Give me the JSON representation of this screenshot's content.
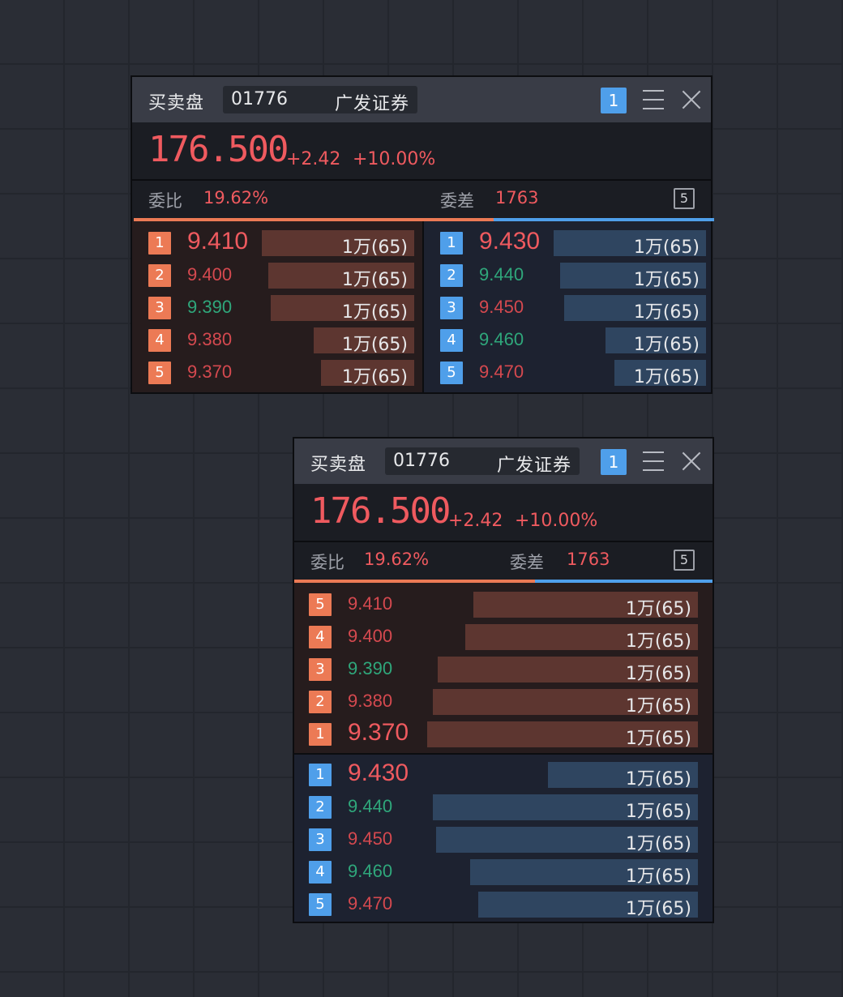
{
  "window": {
    "title": "买卖盘",
    "code": "01776",
    "name": "广发证券",
    "account_badge": "1",
    "price": "176.500",
    "change": "+2.42",
    "change_pct": "+10.00%",
    "ratio_label": "委比",
    "ratio_value": "19.62%",
    "diff_label": "委差",
    "diff_value": "1763",
    "levels_toggle": "5"
  },
  "colors": {
    "up": "#ef5a5f",
    "down": "#2fa77b",
    "bid_bar": "#5d3630",
    "ask_bar": "#2f4560",
    "bid_badge": "#ec7a55",
    "ask_badge": "#4f9fea"
  },
  "panel1": {
    "layout": "side-by-side",
    "depth_bid_share": 0.62,
    "bids": [
      {
        "level": "1",
        "price": "9.410",
        "volume": "1万(65)",
        "trend": "up",
        "fill": 1.0
      },
      {
        "level": "2",
        "price": "9.400",
        "volume": "1万(65)",
        "trend": "up",
        "fill": 0.96
      },
      {
        "level": "3",
        "price": "9.390",
        "volume": "1万(65)",
        "trend": "down",
        "fill": 0.94
      },
      {
        "level": "4",
        "price": "9.380",
        "volume": "1万(65)",
        "trend": "up",
        "fill": 0.66
      },
      {
        "level": "5",
        "price": "9.370",
        "volume": "1万(65)",
        "trend": "up",
        "fill": 0.61
      }
    ],
    "asks": [
      {
        "level": "1",
        "price": "9.430",
        "volume": "1万(65)",
        "trend": "up",
        "fill": 1.0
      },
      {
        "level": "2",
        "price": "9.440",
        "volume": "1万(65)",
        "trend": "down",
        "fill": 0.96
      },
      {
        "level": "3",
        "price": "9.450",
        "volume": "1万(65)",
        "trend": "up",
        "fill": 0.93
      },
      {
        "level": "4",
        "price": "9.460",
        "volume": "1万(65)",
        "trend": "down",
        "fill": 0.66
      },
      {
        "level": "5",
        "price": "9.470",
        "volume": "1万(65)",
        "trend": "up",
        "fill": 0.6
      }
    ]
  },
  "panel2": {
    "layout": "stacked",
    "depth_bid_share": 0.575,
    "bids": [
      {
        "level": "5",
        "price": "9.410",
        "volume": "1万(65)",
        "trend": "up",
        "fill": 0.83
      },
      {
        "level": "4",
        "price": "9.400",
        "volume": "1万(65)",
        "trend": "up",
        "fill": 0.86
      },
      {
        "level": "3",
        "price": "9.390",
        "volume": "1万(65)",
        "trend": "down",
        "fill": 0.96
      },
      {
        "level": "2",
        "price": "9.380",
        "volume": "1万(65)",
        "trend": "up",
        "fill": 0.98
      },
      {
        "level": "1",
        "price": "9.370",
        "volume": "1万(65)",
        "trend": "up",
        "fill": 1.0
      }
    ],
    "asks": [
      {
        "level": "1",
        "price": "9.430",
        "volume": "1万(65)",
        "trend": "up",
        "fill": 0.56
      },
      {
        "level": "2",
        "price": "9.440",
        "volume": "1万(65)",
        "trend": "down",
        "fill": 0.99
      },
      {
        "level": "3",
        "price": "9.450",
        "volume": "1万(65)",
        "trend": "up",
        "fill": 0.98
      },
      {
        "level": "4",
        "price": "9.460",
        "volume": "1万(65)",
        "trend": "down",
        "fill": 0.85
      },
      {
        "level": "5",
        "price": "9.470",
        "volume": "1万(65)",
        "trend": "up",
        "fill": 0.82
      }
    ]
  }
}
